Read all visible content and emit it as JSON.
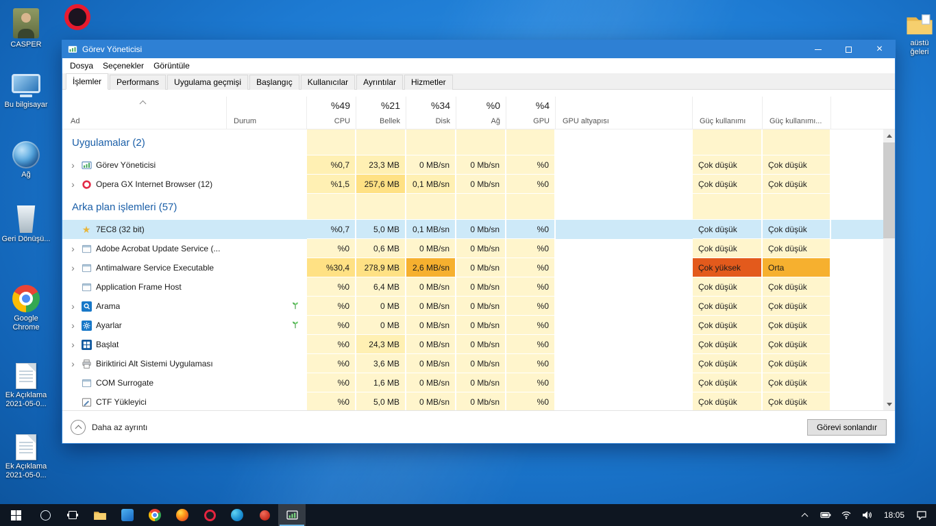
{
  "theme": {
    "titlebar_blue": "#2E80D4",
    "selection_blue": "#CDE9F8",
    "section_text_blue": "#1B5FA8",
    "heat_0": "#FFF5CC",
    "heat_1": "#FFF0B3",
    "heat_2": "#FFE184",
    "heat_3": "#F6B02F",
    "heat_4": "#E35A1C"
  },
  "desktop": {
    "icons": [
      {
        "label": "CASPER",
        "type": "user-avatar"
      },
      {
        "label": "Bu bilgisayar",
        "type": "this-pc"
      },
      {
        "label": "Ağ",
        "type": "network"
      },
      {
        "label": "Geri Dönüşü...",
        "type": "recycle-bin"
      },
      {
        "label": "Google Chrome",
        "type": "chrome"
      },
      {
        "label": "Ek Açıklama 2021-05-0...",
        "type": "document"
      },
      {
        "label": "Ek Açıklama 2021-05-0...",
        "type": "document"
      }
    ],
    "top_right_partial_label": "aüstü ğeleri"
  },
  "taskmanager": {
    "title": "Görev Yöneticisi",
    "menu": [
      "Dosya",
      "Seçenekler",
      "Görüntüle"
    ],
    "tabs": [
      "İşlemler",
      "Performans",
      "Uygulama geçmişi",
      "Başlangıç",
      "Kullanıcılar",
      "Ayrıntılar",
      "Hizmetler"
    ],
    "active_tab": "İşlemler",
    "header": {
      "name": "Ad",
      "status": "Durum",
      "cpu_total": "%49",
      "cpu": "CPU",
      "mem_total": "%21",
      "mem": "Bellek",
      "disk_total": "%34",
      "disk": "Disk",
      "net_total": "%0",
      "net": "Ağ",
      "gpu_total": "%4",
      "gpu": "GPU",
      "gpu_engine": "GPU altyapısı",
      "power": "Güç kullanımı",
      "power_trend": "Güç kullanımı..."
    },
    "groups": [
      {
        "label": "Uygulamalar (2)",
        "rows": [
          {
            "name": "Görev Yöneticisi",
            "icon": "taskmgr",
            "expand": true,
            "cpu": "%0,7",
            "mem": "23,3 MB",
            "disk": "0 MB/sn",
            "net": "0 Mb/sn",
            "gpu": "%0",
            "gpu_engine": "",
            "power": "Çok düşük",
            "power_trend": "Çok düşük",
            "heat": {
              "cpu": 1,
              "mem": 1
            }
          },
          {
            "name": "Opera GX Internet Browser (12)",
            "icon": "opera",
            "expand": true,
            "cpu": "%1,5",
            "mem": "257,6 MB",
            "disk": "0,1 MB/sn",
            "net": "0 Mb/sn",
            "gpu": "%0",
            "gpu_engine": "",
            "power": "Çok düşük",
            "power_trend": "Çok düşük",
            "heat": {
              "cpu": 1,
              "mem": 2,
              "disk": 1
            }
          }
        ]
      },
      {
        "label": "Arka plan işlemleri (57)",
        "rows": [
          {
            "name": "7EC8 (32 bit)",
            "icon": "star",
            "expand": false,
            "selected": true,
            "cpu": "%0,7",
            "mem": "5,0 MB",
            "disk": "0,1 MB/sn",
            "net": "0 Mb/sn",
            "gpu": "%0",
            "gpu_engine": "",
            "power": "Çok düşük",
            "power_trend": "Çok düşük",
            "heat": {
              "cpu": 1,
              "disk": 1
            }
          },
          {
            "name": "Adobe Acrobat Update Service (...",
            "icon": "window",
            "expand": true,
            "cpu": "%0",
            "mem": "0,6 MB",
            "disk": "0 MB/sn",
            "net": "0 Mb/sn",
            "gpu": "%0",
            "gpu_engine": "",
            "power": "Çok düşük",
            "power_trend": "Çok düşük",
            "heat": {}
          },
          {
            "name": "Antimalware Service Executable",
            "icon": "window",
            "expand": true,
            "cpu": "%30,4",
            "mem": "278,9 MB",
            "disk": "2,6 MB/sn",
            "net": "0 Mb/sn",
            "gpu": "%0",
            "gpu_engine": "",
            "power": "Çok yüksek",
            "power_trend": "Orta",
            "heat": {
              "cpu": 2,
              "mem": 2,
              "disk": 3,
              "power": 4,
              "power_trend": 3
            }
          },
          {
            "name": "Application Frame Host",
            "icon": "window",
            "expand": false,
            "cpu": "%0",
            "mem": "6,4 MB",
            "disk": "0 MB/sn",
            "net": "0 Mb/sn",
            "gpu": "%0",
            "gpu_engine": "",
            "power": "Çok düşük",
            "power_trend": "Çok düşük",
            "heat": {}
          },
          {
            "name": "Arama",
            "icon": "search",
            "expand": true,
            "suspended": true,
            "cpu": "%0",
            "mem": "0 MB",
            "disk": "0 MB/sn",
            "net": "0 Mb/sn",
            "gpu": "%0",
            "gpu_engine": "",
            "power": "Çok düşük",
            "power_trend": "Çok düşük",
            "heat": {}
          },
          {
            "name": "Ayarlar",
            "icon": "settings",
            "expand": true,
            "suspended": true,
            "cpu": "%0",
            "mem": "0 MB",
            "disk": "0 MB/sn",
            "net": "0 Mb/sn",
            "gpu": "%0",
            "gpu_engine": "",
            "power": "Çok düşük",
            "power_trend": "Çok düşük",
            "heat": {}
          },
          {
            "name": "Başlat",
            "icon": "start",
            "expand": true,
            "cpu": "%0",
            "mem": "24,3 MB",
            "disk": "0 MB/sn",
            "net": "0 Mb/sn",
            "gpu": "%0",
            "gpu_engine": "",
            "power": "Çok düşük",
            "power_trend": "Çok düşük",
            "heat": {
              "mem": 1
            }
          },
          {
            "name": "Biriktirici Alt Sistemi Uygulaması",
            "icon": "printer",
            "expand": true,
            "cpu": "%0",
            "mem": "3,6 MB",
            "disk": "0 MB/sn",
            "net": "0 Mb/sn",
            "gpu": "%0",
            "gpu_engine": "",
            "power": "Çok düşük",
            "power_trend": "Çok düşük",
            "heat": {}
          },
          {
            "name": "COM Surrogate",
            "icon": "window",
            "expand": false,
            "cpu": "%0",
            "mem": "1,6 MB",
            "disk": "0 MB/sn",
            "net": "0 Mb/sn",
            "gpu": "%0",
            "gpu_engine": "",
            "power": "Çok düşük",
            "power_trend": "Çok düşük",
            "heat": {}
          },
          {
            "name": "CTF Yükleyici",
            "icon": "ctf",
            "expand": false,
            "cpu": "%0",
            "mem": "5,0 MB",
            "disk": "0 MB/sn",
            "net": "0 Mb/sn",
            "gpu": "%0",
            "gpu_engine": "",
            "power": "Çok düşük",
            "power_trend": "Çok düşük",
            "heat": {}
          }
        ]
      }
    ],
    "footer": {
      "details_toggle": "Daha az ayrıntı",
      "end_task_button": "Görevi sonlandır"
    }
  },
  "taskbar": {
    "clock_time": "18:05"
  }
}
